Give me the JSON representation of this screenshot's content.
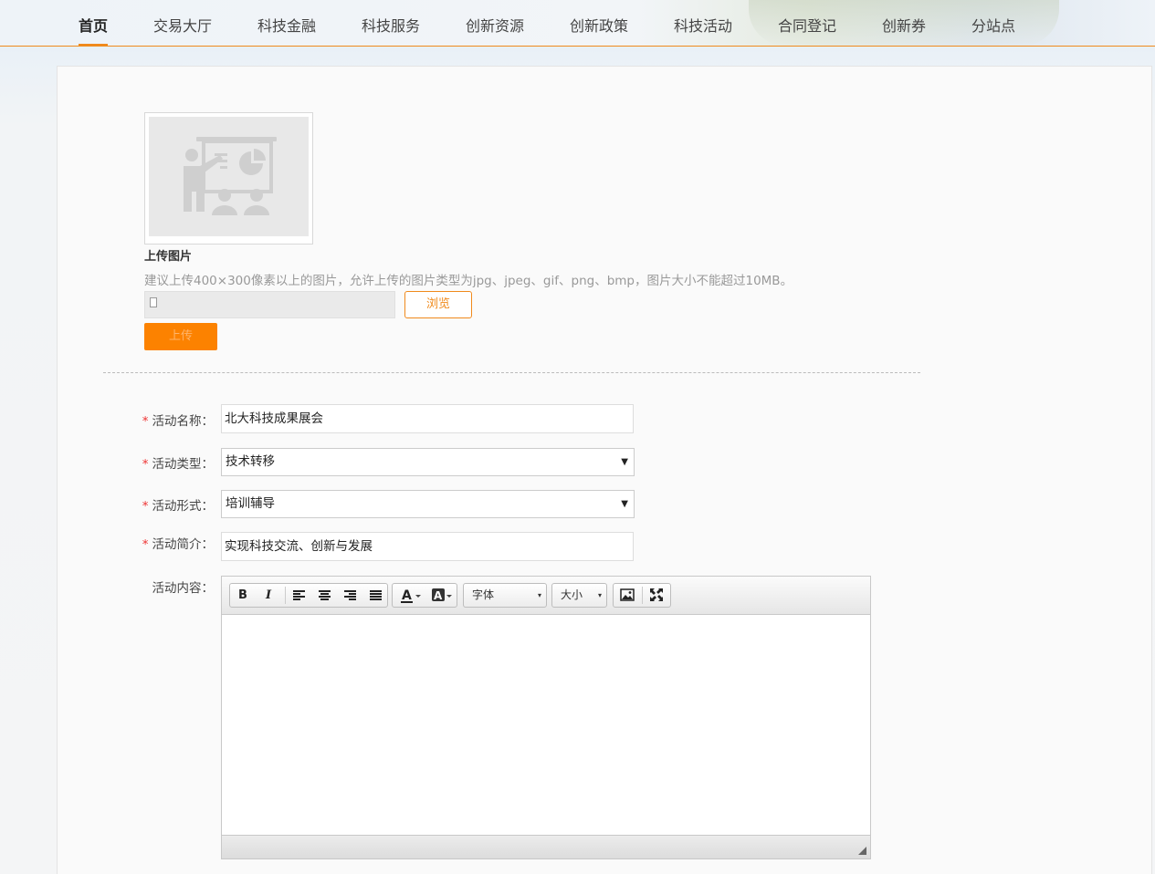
{
  "nav": {
    "items": [
      {
        "label": "首页",
        "active": true
      },
      {
        "label": "交易大厅"
      },
      {
        "label": "科技金融"
      },
      {
        "label": "科技服务"
      },
      {
        "label": "创新资源"
      },
      {
        "label": "创新政策"
      },
      {
        "label": "科技活动"
      },
      {
        "label": "合同登记"
      },
      {
        "label": "创新券"
      },
      {
        "label": "分站点"
      }
    ]
  },
  "upload": {
    "placeholder_icon": "presentation-icon",
    "title": "上传图片",
    "hint": "建议上传400×300像素以上的图片，允许上传的图片类型为jpg、jpeg、gif、png、bmp，图片大小不能超过10MB。",
    "file_value": "",
    "file_icon": "document-icon",
    "browse_label": "浏览",
    "upload_label": "上传"
  },
  "form": {
    "required_mark": "*",
    "name": {
      "label": "活动名称：",
      "value": "北大科技成果展会"
    },
    "type": {
      "label": "活动类型：",
      "value": "技术转移"
    },
    "format": {
      "label": "活动形式：",
      "value": "培训辅导"
    },
    "summary": {
      "label": "活动简介：",
      "value": "实现科技交流、创新与发展"
    },
    "content": {
      "label": "活动内容：",
      "value": ""
    }
  },
  "editor": {
    "bold": "B",
    "italic": "I",
    "font_label": "字体",
    "size_label": "大小",
    "dropdown_caret": "▾",
    "select_caret": "▼"
  },
  "colors": {
    "accent": "#f08a1c",
    "button": "#fc8200",
    "required": "#e33333"
  }
}
